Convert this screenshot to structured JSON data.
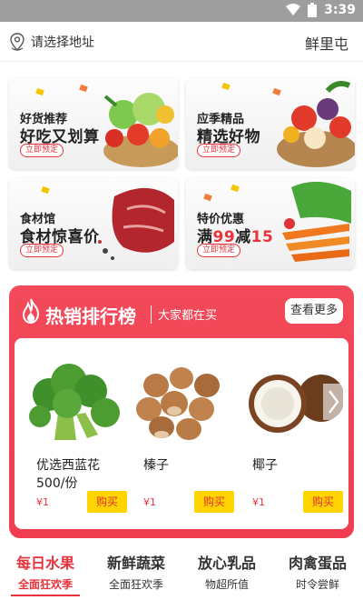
{
  "status_bar": {
    "time": "3:39"
  },
  "header": {
    "location_label": "请选择地址",
    "brand": "鲜里屯"
  },
  "banners": [
    {
      "subtitle": "好货推荐",
      "title_main": "好吃又划算",
      "title_red": "",
      "title_tail": "",
      "button": "立即预定"
    },
    {
      "subtitle": "应季精品",
      "title_main": "精选好物",
      "title_red": "",
      "title_tail": "",
      "button": "立即预定"
    },
    {
      "subtitle": "食材馆",
      "title_main": "食材惊喜价",
      "title_red": "",
      "title_tail": "",
      "button": "立即预定"
    },
    {
      "subtitle": "特价优惠",
      "title_main": "满",
      "title_red": "99",
      "title_mid": "减",
      "title_tail": "15",
      "button": "立即预定"
    }
  ],
  "hot_section": {
    "title": "热销排行榜",
    "subtitle": "大家都在买",
    "more_label": "查看更多",
    "products": [
      {
        "name": "优选西蓝花500/份",
        "price": "¥1",
        "buy_label": "购买"
      },
      {
        "name": "榛子",
        "price": "¥1",
        "buy_label": "购买"
      },
      {
        "name": "椰子",
        "price": "¥1",
        "buy_label": "购买"
      }
    ]
  },
  "tabs": [
    {
      "title": "每日水果",
      "subtitle": "全面狂欢季",
      "active": true
    },
    {
      "title": "新鲜蔬菜",
      "subtitle": "全面狂欢季",
      "active": false
    },
    {
      "title": "放心乳品",
      "subtitle": "物超所值",
      "active": false
    },
    {
      "title": "肉禽蛋品",
      "subtitle": "时令尝鲜",
      "active": false
    }
  ],
  "colors": {
    "accent": "#e8323c",
    "hot_bg": "#f04455",
    "buy_bg": "#ffd400"
  },
  "icons": [
    "wifi-icon",
    "battery-icon",
    "location-pin-icon",
    "flame-icon",
    "chevron-right-icon"
  ]
}
